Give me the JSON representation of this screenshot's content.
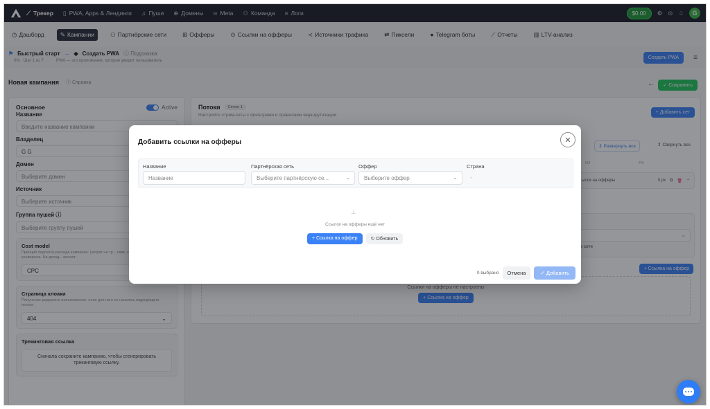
{
  "topbar": {
    "items": [
      {
        "label": "Трекер",
        "active": true
      },
      {
        "label": "PWA, Apps & Лендинги"
      },
      {
        "label": "Пуши"
      },
      {
        "label": "Домены"
      },
      {
        "label": "Meta"
      },
      {
        "label": "Команда"
      },
      {
        "label": "Логи"
      }
    ],
    "balance": "$0.00",
    "avatar": "G"
  },
  "subnav": {
    "items": [
      {
        "label": "Дашборд"
      },
      {
        "label": "Кампании",
        "active": true
      },
      {
        "label": "Партнёрские сети"
      },
      {
        "label": "Офферы"
      },
      {
        "label": "Ссылки на офферы"
      },
      {
        "label": "Источники трафика"
      },
      {
        "label": "Пиксели"
      },
      {
        "label": "Telegram боты"
      },
      {
        "label": "Отчеты"
      },
      {
        "label": "LTV-анализ"
      }
    ]
  },
  "breadcrumb": {
    "quickstart": "Быстрый старт",
    "step": "Создать PWA",
    "hint": "Подсказка",
    "progress": "0% · Шаг 1 из 7",
    "desc": "PWA — это приложение, которое увидит пользователь",
    "create_pwa": "Создать PWA"
  },
  "page": {
    "title": "Новая кампания",
    "help": "Справка",
    "save": "Сохранить"
  },
  "left": {
    "section": "Основное",
    "active": "Active",
    "name_label": "Название",
    "name_placeholder": "Введите название кампании",
    "owner_label": "Владелец",
    "owner_value": "G G",
    "domain_label": "Домен",
    "domain_placeholder": "Выберите домен",
    "source_label": "Источник",
    "source_placeholder": "Выберите источник",
    "push_label": "Группа пушей",
    "push_placeholder": "Выберите группу пушей",
    "cost_title": "Cost model",
    "cost_desc": "Принцип подсчёта расхода кампании: (затрат на тр... клик, за тысячу показов или за конверсию. На доход... влияет.",
    "cost_value": "CPC",
    "click_title": "Страница клоаки",
    "click_desc": "Получение редиректа пользователю, если для него не нашлось подходящего потока",
    "click_value": "404",
    "track_title": "Трекинговая ссылка",
    "track_note": "Сначала сохраните кампанию, чтобы сгенерировать трекинговую ссылку."
  },
  "right": {
    "title": "Потоки",
    "count": "Сетов: 1",
    "subtitle": "Настройте стрим-сеты с фильтрами и правилами маршрутизации",
    "add_set": "Добавить сет",
    "expand_all": "Развернуть все",
    "collapse_all": "Свернуть все",
    "col1": "ИЗ",
    "col2": "PX",
    "row_label": "ылок на офферы",
    "row_px": "0 px",
    "inner_text": "ом сете",
    "offer_link_btn": "Ссылка на оффер",
    "empty_text": "Ссылки на офферы не настроены",
    "empty_btn": "Ссылка на оффер"
  },
  "modal": {
    "title": "Добавить ссылки на офферы",
    "col_name": "Название",
    "col_network": "Партнёрская сеть",
    "col_offer": "Оффер",
    "col_country": "Страна",
    "name_placeholder": "Название",
    "network_placeholder": "Выберите партнёрскую се...",
    "offer_placeholder": "Выберите оффер",
    "country_value": "-",
    "empty": "Ссылок на офферы ещё нет",
    "add_btn": "Ссылка на оффер",
    "refresh_btn": "Обновить",
    "selected": "0 выбрано",
    "cancel": "Отмена",
    "submit": "Добавить"
  },
  "colors": {
    "accent": "#3b82f6",
    "success": "#22c55e",
    "dark": "#1c1f2b"
  }
}
